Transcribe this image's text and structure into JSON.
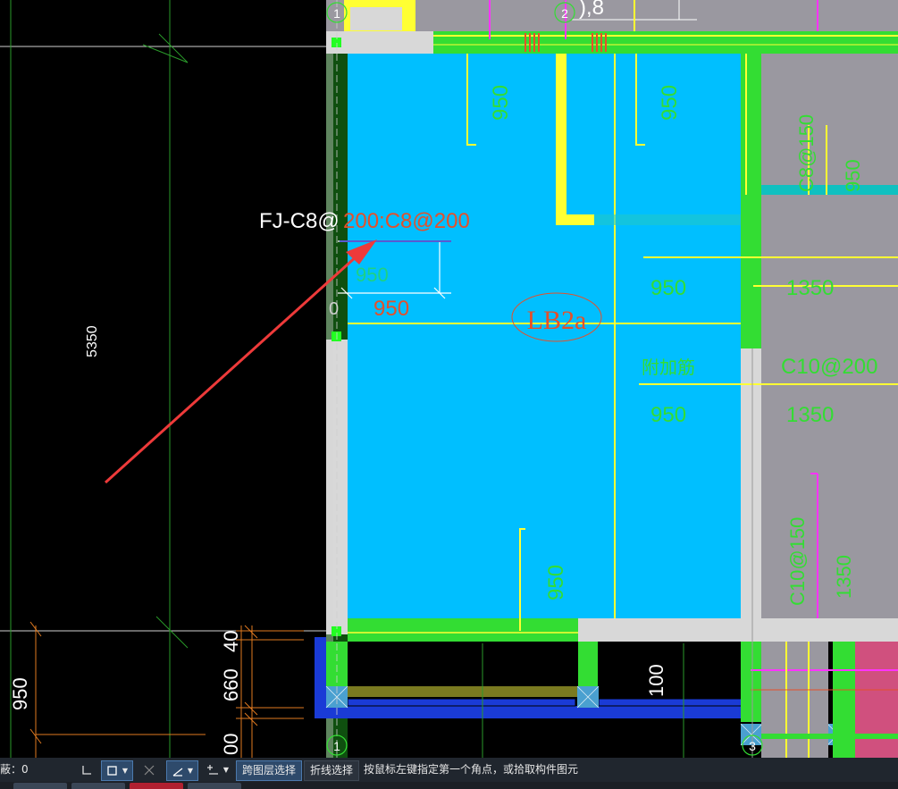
{
  "drawing": {
    "texts": {
      "rebar_label_white": "FJ-C8@",
      "rebar_label_red": "200:C8@200",
      "dim_5350": "5350",
      "dim_950_red": "950",
      "dim_950_top_left": "950",
      "dim_950_top_mid": "950",
      "dim_950_right_1": "950",
      "dim_950_right_2": "950",
      "dim_950_bottom": "950",
      "dim_950_left_bottom": "950",
      "dim_950_hidden": "950",
      "slab_tag": "LB2a",
      "extra_bar": "附加筋",
      "dim_1350_1": "1350",
      "dim_1350_2": "1350",
      "dim_1350_3": "1350",
      "spec_c10": "C10@200",
      "spec_c8": "C8@150",
      "spec_c10b": "C10@150",
      "dim_950_vert": "950",
      "dim_40": "40",
      "dim_660": "660",
      "dim_00": "00",
      "dim_100": "100",
      "axis_top_left": "1",
      "axis_top_mid": "2",
      "axis_bottom": "1",
      "axis_bottom_right": "3",
      "top_partial": "),8",
      "zero": "0"
    },
    "colors": {
      "slab": "#00bfff",
      "beam_green": "#33dd33",
      "beam_grey": "#d8d8d8",
      "rebar_yellow": "#ffff33",
      "magenta": "#ff33ff",
      "red_text": "#e5502a",
      "arrow": "#ee3a3a",
      "right_grey": "#9a98a0",
      "pink": "#d0507e",
      "dark_blue": "#1a3bd6"
    }
  },
  "statusbar": {
    "layer_label": "蔽：0",
    "cross_layer_select": "跨图层选择",
    "polyline_select": "折线选择",
    "prompt": "按鼠标左键指定第一个角点，或拾取构件图元"
  }
}
